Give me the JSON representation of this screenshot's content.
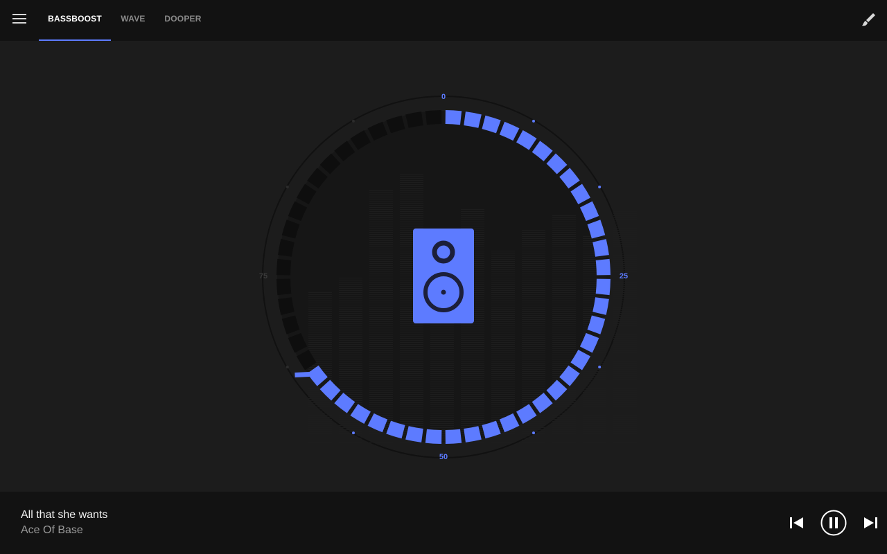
{
  "tabs": [
    {
      "label": "BASSBOOST",
      "active": true
    },
    {
      "label": "WAVE",
      "active": false
    },
    {
      "label": "DOOPER",
      "active": false
    }
  ],
  "dial": {
    "value_percent": 65,
    "labels": {
      "top": "0",
      "right": "25",
      "bottom": "50",
      "left": "75"
    }
  },
  "now_playing": {
    "title": "All that she wants",
    "artist": "Ace Of Base"
  },
  "colors": {
    "accent": "#5d7bff",
    "background": "#1c1c1c",
    "bar": "#121212",
    "inactive_segment": "#0e0e0e"
  },
  "icons": {
    "menu": "menu-icon",
    "brush": "paintbrush-icon",
    "speaker": "speaker-icon",
    "previous": "skip-previous-icon",
    "pause": "pause-icon",
    "next": "skip-next-icon"
  }
}
